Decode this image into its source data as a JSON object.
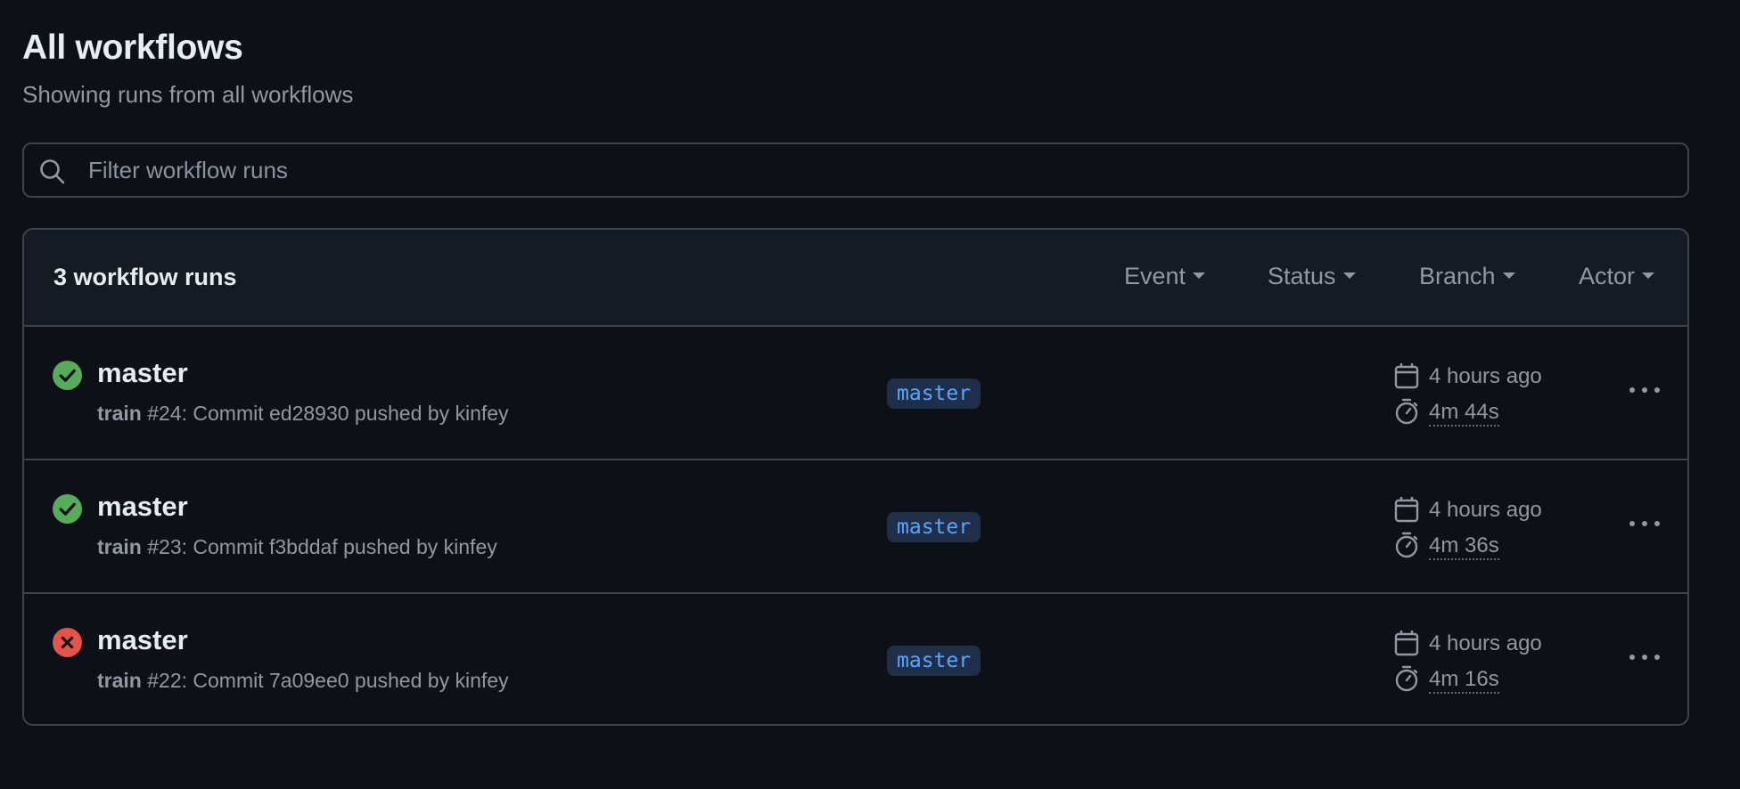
{
  "header": {
    "title": "All workflows",
    "subtitle": "Showing runs from all workflows"
  },
  "search": {
    "icon": "search-icon",
    "placeholder": "Filter workflow runs",
    "value": ""
  },
  "runs": {
    "count_label": "3 workflow runs",
    "filters": {
      "event": "Event",
      "status": "Status",
      "branch": "Branch",
      "actor": "Actor"
    },
    "items": [
      {
        "title": "master",
        "status": "success",
        "workflow": "train",
        "run_info": "#24: Commit ed28930 pushed by kinfey",
        "branch": "master",
        "time_ago": "4 hours ago",
        "duration": "4m 44s"
      },
      {
        "title": "master",
        "status": "success",
        "workflow": "train",
        "run_info": "#23: Commit f3bddaf pushed by kinfey",
        "branch": "master",
        "time_ago": "4 hours ago",
        "duration": "4m 36s"
      },
      {
        "title": "master",
        "status": "failure",
        "workflow": "train",
        "run_info": "#22: Commit 7a09ee0 pushed by kinfey",
        "branch": "master",
        "time_ago": "4 hours ago",
        "duration": "4m 16s"
      }
    ]
  },
  "colors": {
    "background": "#0d1117",
    "header_bg": "#151b23",
    "border": "#3d444d",
    "success": "#57ab5a",
    "failure": "#e5534b",
    "branch_tag_bg": "#1f2f4a",
    "branch_tag_text": "#58a6ff"
  }
}
